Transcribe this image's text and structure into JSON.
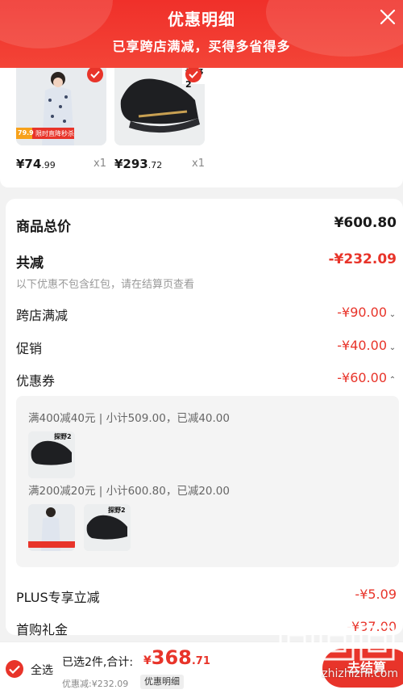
{
  "header": {
    "title": "优惠明细",
    "subtitle": "已享跨店满减，买得多省得多"
  },
  "products": [
    {
      "price_main": "¥74",
      "price_decimal": ".99",
      "qty": "x1",
      "badge_price": "79.9",
      "badge_text": "限时直降秒杀"
    },
    {
      "price_main": "¥293",
      "price_decimal": ".72",
      "qty": "x1",
      "label": "探野2"
    }
  ],
  "summary": {
    "total_label": "商品总价",
    "total_value": "¥600.80",
    "reduce_label": "共减",
    "reduce_value": "-¥232.09",
    "note": "以下优惠不包含红包，请在结算页查看",
    "items": [
      {
        "label": "跨店满减",
        "value": "-¥90.00"
      },
      {
        "label": "促销",
        "value": "-¥40.00"
      },
      {
        "label": "优惠券",
        "value": "-¥60.00"
      }
    ],
    "coupons": [
      {
        "line": "满400减40元 | 小计509.00，已减40.00"
      },
      {
        "line": "满200减20元 | 小计600.80，已减20.00"
      }
    ],
    "plus_label": "PLUS专享立减",
    "plus_value": "-¥5.09",
    "gift_label": "首购礼金",
    "gift_value": "-¥37.00"
  },
  "bottom": {
    "select_all": "全选",
    "selected": "已选2件,合计:",
    "currency": "¥",
    "amount_int": "368",
    "amount_dec": ".71",
    "discount": "优惠减:¥232.09",
    "detail_btn": "优惠明细",
    "checkout": "去结算"
  },
  "watermark": {
    "url": "zhizhizhi.com"
  },
  "colors": {
    "accent": "#e8342a",
    "header": "#f0302a"
  }
}
